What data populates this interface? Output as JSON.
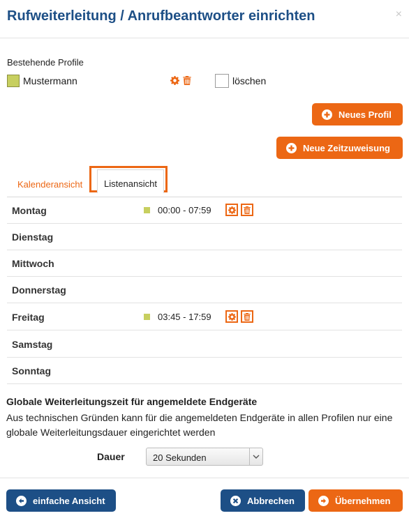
{
  "dialog": {
    "title": "Rufweiterleitung / Anrufbeantworter einrichten",
    "close_symbol": "×"
  },
  "profiles": {
    "label": "Bestehende Profile",
    "items": [
      {
        "name": "Mustermann",
        "color": "#c7cf5f",
        "delete_label": "löschen"
      }
    ]
  },
  "buttons": {
    "new_profile": "Neues Profil",
    "new_time": "Neue Zeitzuweisung",
    "simple_view": "einfache Ansicht",
    "cancel": "Abbrechen",
    "apply": "Übernehmen"
  },
  "tabs": [
    {
      "label": "Kalenderansicht",
      "active": false
    },
    {
      "label": "Listenansicht",
      "active": true
    }
  ],
  "days": [
    {
      "name": "Montag",
      "slot": "00:00 - 07:59"
    },
    {
      "name": "Dienstag",
      "slot": ""
    },
    {
      "name": "Mittwoch",
      "slot": ""
    },
    {
      "name": "Donnerstag",
      "slot": ""
    },
    {
      "name": "Freitag",
      "slot": "03:45 - 17:59"
    },
    {
      "name": "Samstag",
      "slot": ""
    },
    {
      "name": "Sonntag",
      "slot": ""
    }
  ],
  "global": {
    "title": "Globale Weiterleitungszeit für angemeldete Endgeräte",
    "description": "Aus technischen Gründen kann für die angemeldeten Endgeräte in allen Profilen nur eine globale Weiterleitungsdauer eingerichtet werden",
    "duration_label": "Dauer",
    "duration_value": "20 Sekunden"
  },
  "colors": {
    "brand_blue": "#1d4f86",
    "accent_orange": "#ec6714",
    "profile_green": "#c7cf5f"
  }
}
